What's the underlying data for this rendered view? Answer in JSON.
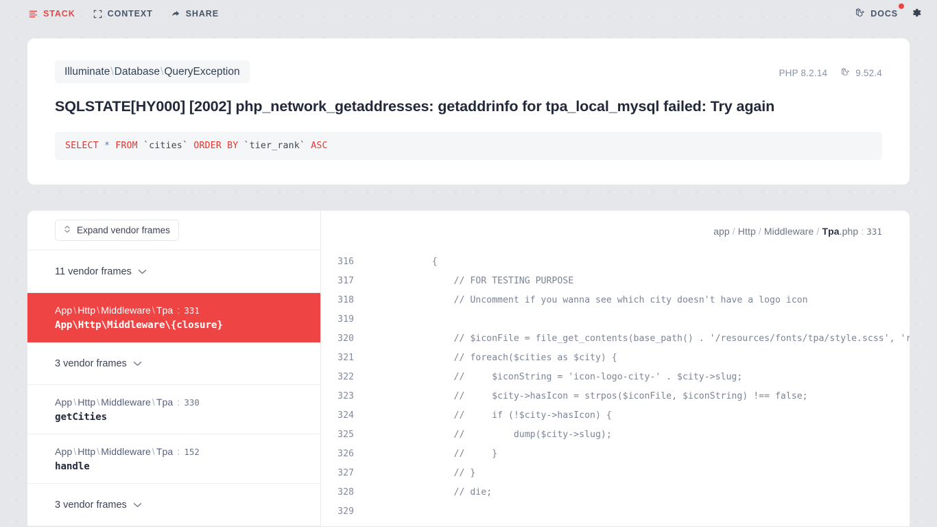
{
  "topbar": {
    "nav": [
      {
        "label": "STACK",
        "icon": "stack-lines-icon",
        "active": true
      },
      {
        "label": "CONTEXT",
        "icon": "crop-frame-icon",
        "active": false
      },
      {
        "label": "SHARE",
        "icon": "share-arrow-icon",
        "active": false
      }
    ],
    "docs_label": "DOCS",
    "docs_icon": "laravel-logo-icon",
    "settings_icon": "gear-icon",
    "accent_color": "#ef4444",
    "notification_dot_color": "#ef4444"
  },
  "exception": {
    "class_parts": [
      "Illuminate",
      "Database",
      "QueryException"
    ],
    "separator": "\\",
    "php_version": "PHP 8.2.14",
    "laravel_version": "9.52.4",
    "laravel_icon": "laravel-logo-icon",
    "message": "SQLSTATE[HY000] [2002] php_network_getaddresses: getaddrinfo for tpa_local_mysql failed: Try again",
    "query_tokens": [
      {
        "t": "SELECT",
        "c": "kw"
      },
      {
        "t": " ",
        "c": "idn"
      },
      {
        "t": "*",
        "c": "op"
      },
      {
        "t": " ",
        "c": "idn"
      },
      {
        "t": "FROM",
        "c": "kw"
      },
      {
        "t": " `cities` ",
        "c": "idn"
      },
      {
        "t": "ORDER BY",
        "c": "kw"
      },
      {
        "t": " `tier_rank` ",
        "c": "idn"
      },
      {
        "t": "ASC",
        "c": "kw"
      }
    ]
  },
  "frames_panel": {
    "expand_button_label": "Expand vendor frames",
    "expand_button_icon": "chevron-up-down-icon",
    "chevron_icon": "chevron-down-icon",
    "rows": [
      {
        "kind": "vendor",
        "label": "11 vendor frames"
      },
      {
        "kind": "app",
        "active": true,
        "path_parts": [
          "App",
          "Http",
          "Middleware",
          "Tpa"
        ],
        "line": "331",
        "fn": "App\\Http\\Middleware\\{closure}"
      },
      {
        "kind": "vendor",
        "label": "3 vendor frames"
      },
      {
        "kind": "app",
        "active": false,
        "path_parts": [
          "App",
          "Http",
          "Middleware",
          "Tpa"
        ],
        "line": "330",
        "fn": "getCities"
      },
      {
        "kind": "app",
        "active": false,
        "path_parts": [
          "App",
          "Http",
          "Middleware",
          "Tpa"
        ],
        "line": "152",
        "fn": "handle"
      },
      {
        "kind": "vendor",
        "label": "3 vendor frames"
      }
    ]
  },
  "code_panel": {
    "path_parts": [
      "app",
      "Http",
      "Middleware"
    ],
    "file_name": "Tpa",
    "file_ext": ".php",
    "line_number": "331",
    "separator": "/",
    "lines": [
      {
        "n": "316",
        "src": "    {"
      },
      {
        "n": "317",
        "src": "        // FOR TESTING PURPOSE"
      },
      {
        "n": "318",
        "src": "        // Uncomment if you wanna see which city doesn't have a logo icon"
      },
      {
        "n": "319",
        "src": ""
      },
      {
        "n": "320",
        "src": "        // $iconFile = file_get_contents(base_path() . '/resources/fonts/tpa/style.scss', 'r"
      },
      {
        "n": "321",
        "src": "        // foreach($cities as $city) {"
      },
      {
        "n": "322",
        "src": "        //     $iconString = 'icon-logo-city-' . $city->slug;"
      },
      {
        "n": "323",
        "src": "        //     $city->hasIcon = strpos($iconFile, $iconString) !== false;"
      },
      {
        "n": "324",
        "src": "        //     if (!$city->hasIcon) {"
      },
      {
        "n": "325",
        "src": "        //         dump($city->slug);"
      },
      {
        "n": "326",
        "src": "        //     }"
      },
      {
        "n": "327",
        "src": "        // }"
      },
      {
        "n": "328",
        "src": "        // die;"
      },
      {
        "n": "329",
        "src": ""
      }
    ]
  }
}
